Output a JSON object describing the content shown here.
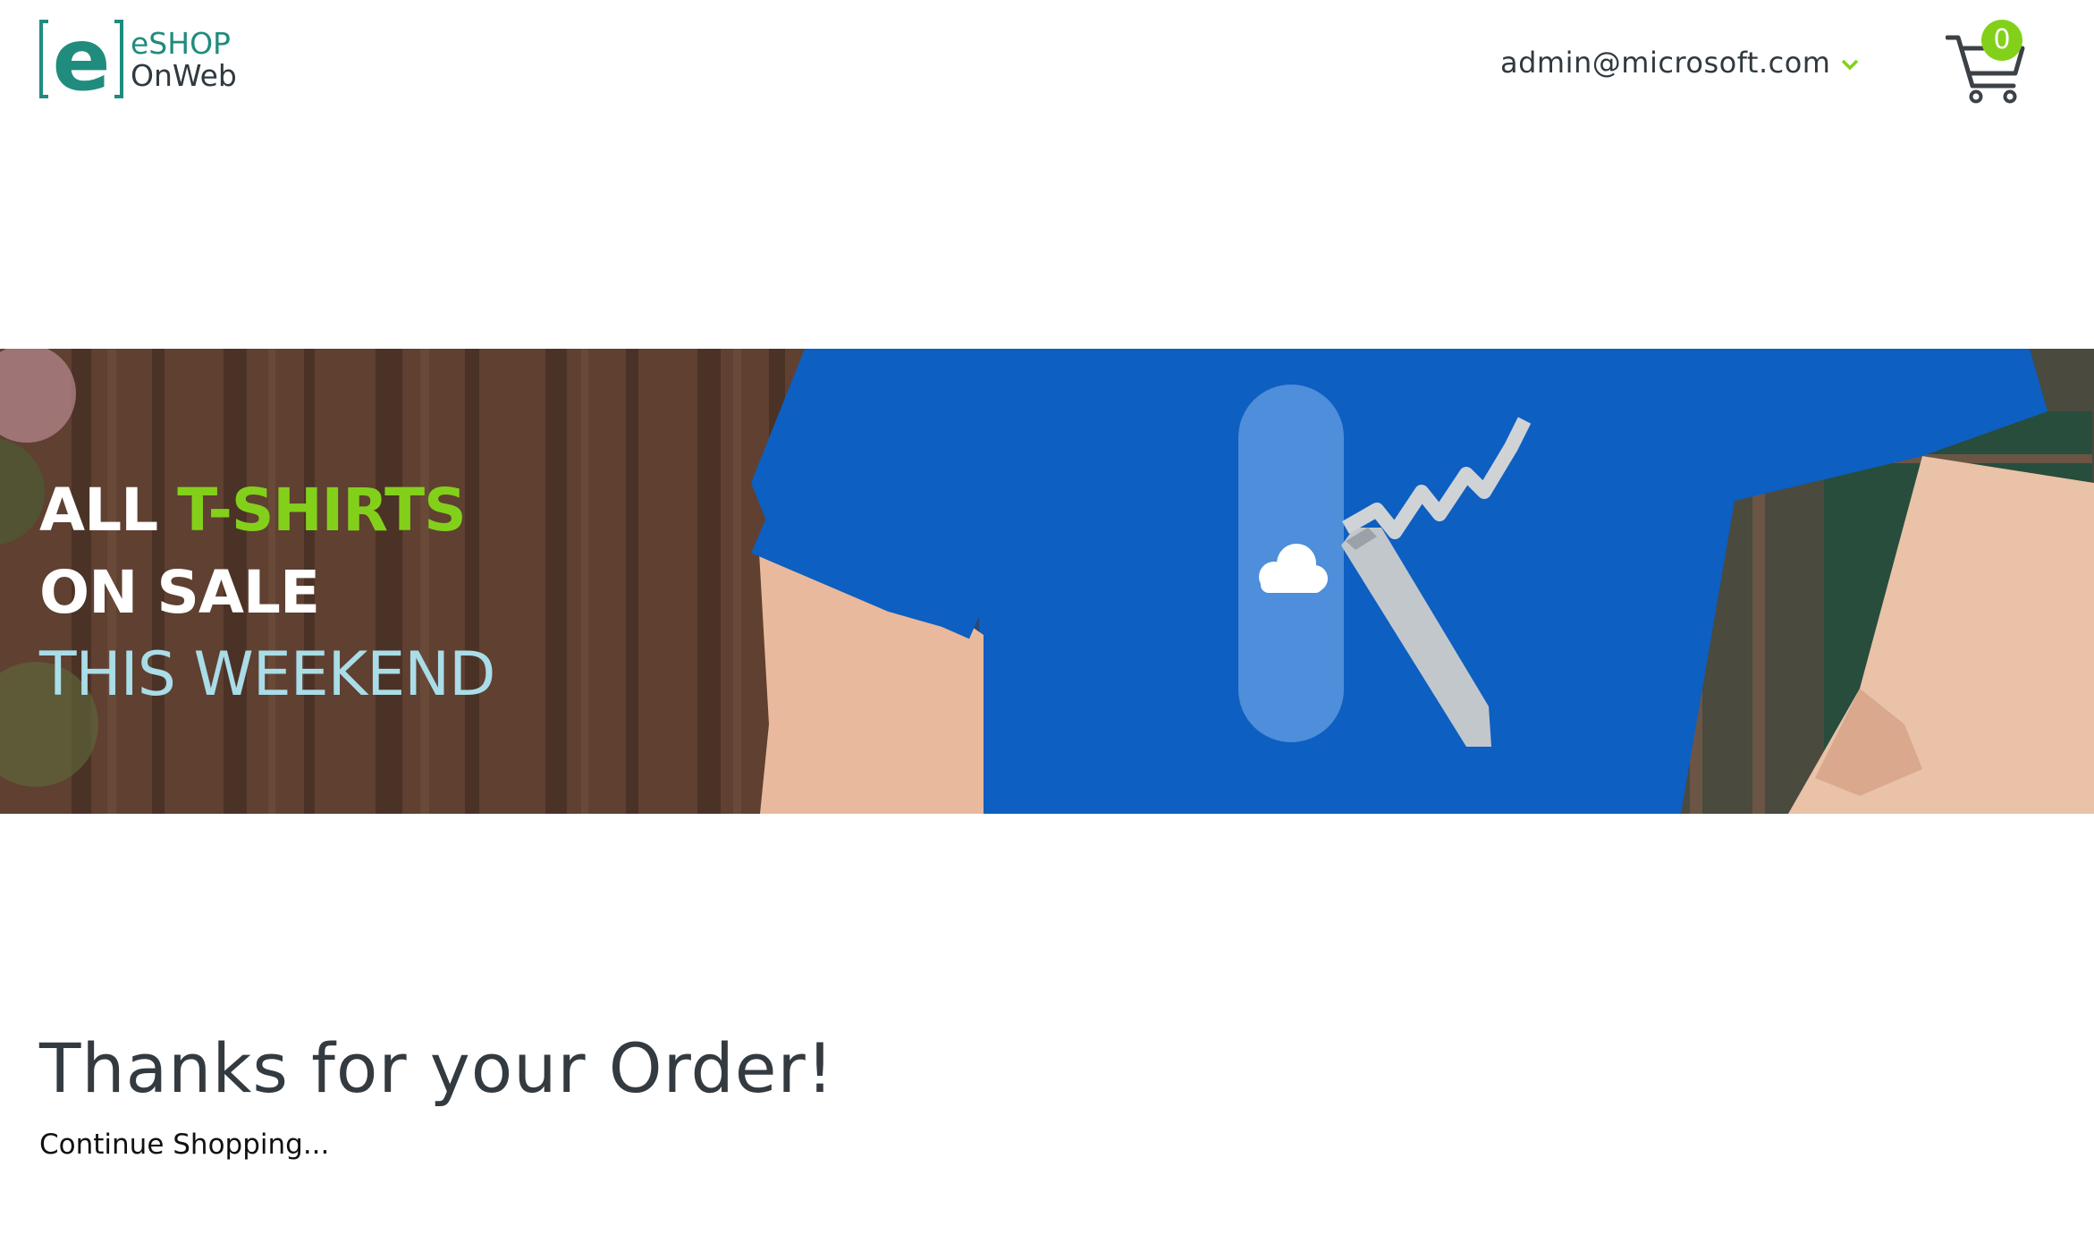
{
  "header": {
    "logo": {
      "line1": "eSHOP",
      "line2": "OnWeb",
      "letter": "e",
      "icon": "eshop-logo-icon",
      "color": "#1f8c7e"
    },
    "user": {
      "email": "admin@microsoft.com",
      "dropdown_icon": "chevron-down-icon"
    },
    "cart": {
      "icon": "shopping-cart-icon",
      "count": "0",
      "badge_color": "#83d01b"
    }
  },
  "hero": {
    "line1_white": "ALL",
    "line1_green": "T-SHIRTS",
    "line2": "ON SALE",
    "line3": "THIS WEEKEND",
    "image": "man-wearing-blue-tshirt-with-knife-logo",
    "shirt_color": "#0d5fc1"
  },
  "main": {
    "title": "Thanks for your Order!",
    "continue_link": "Continue Shopping..."
  },
  "colors": {
    "accent_green": "#83d01b",
    "text_dark": "#333a40",
    "hero_light_blue": "#a9dde8"
  }
}
